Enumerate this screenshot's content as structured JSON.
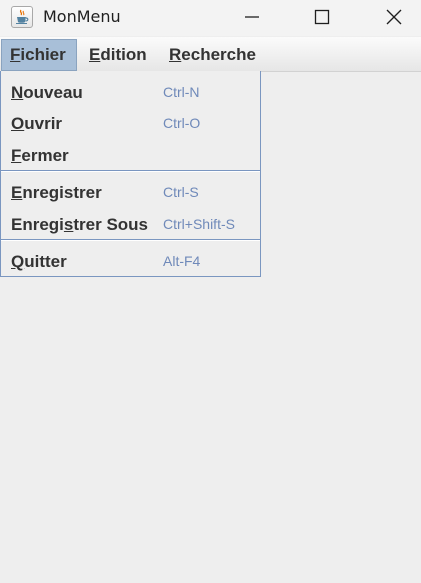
{
  "window": {
    "title": "MonMenu",
    "app_icon": "java-cup-icon"
  },
  "menubar": {
    "items": [
      {
        "mnemonic": "F",
        "rest": "ichier",
        "selected": true
      },
      {
        "mnemonic": "E",
        "rest": "dition",
        "selected": false
      },
      {
        "mnemonic": "R",
        "rest": "echerche",
        "selected": false
      }
    ]
  },
  "dropdown": {
    "items": [
      {
        "pre": "",
        "mnemonic": "N",
        "post": "ouveau",
        "accelerator": "Ctrl-N"
      },
      {
        "pre": "",
        "mnemonic": "O",
        "post": "uvrir",
        "accelerator": "Ctrl-O"
      },
      {
        "pre": "",
        "mnemonic": "F",
        "post": "ermer",
        "accelerator": ""
      },
      {
        "pre": "",
        "mnemonic": "E",
        "post": "nregistrer",
        "accelerator": "Ctrl-S"
      },
      {
        "pre": "Enregi",
        "mnemonic": "s",
        "post": "trer Sous",
        "accelerator": "Ctrl+Shift-S"
      },
      {
        "pre": "",
        "mnemonic": "Q",
        "post": "uitter",
        "accelerator": "Alt-F4"
      }
    ]
  },
  "colors": {
    "menu_selected_bg": "#a8bfd8",
    "accelerator_text": "#6f89b9",
    "dropdown_border": "#7a96c0"
  }
}
